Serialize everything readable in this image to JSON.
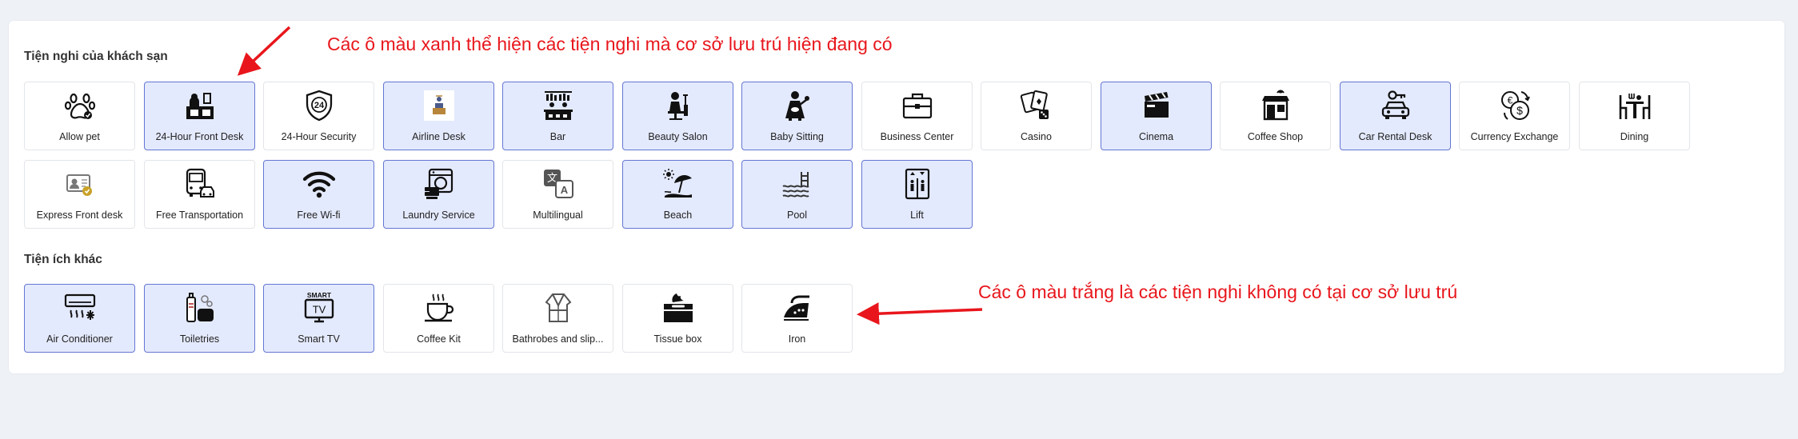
{
  "sections": {
    "hotel_title": "Tiện nghi của khách sạn",
    "other_title": "Tiện ích khác"
  },
  "annotations": {
    "blue_note": "Các ô màu xanh thể hiện các tiện nghi mà cơ sở lưu trú hiện đang có",
    "white_note": "Các ô màu trắng là các tiện nghi không có tại cơ sở lưu trú",
    "color": "#e8161c"
  },
  "colors": {
    "active_bg": "#e4eafd",
    "active_border": "#6476d3",
    "page_bg": "#eef1f6"
  },
  "hotel_amenities": [
    {
      "label": "Allow pet",
      "icon": "paw-icon",
      "active": false
    },
    {
      "label": "24-Hour Front Desk",
      "icon": "front-desk-icon",
      "active": true
    },
    {
      "label": "24-Hour Security",
      "icon": "shield-24-icon",
      "active": false
    },
    {
      "label": "Airline Desk",
      "icon": "airline-desk-icon",
      "active": true
    },
    {
      "label": "Bar",
      "icon": "bar-icon",
      "active": true
    },
    {
      "label": "Beauty Salon",
      "icon": "beauty-salon-icon",
      "active": true
    },
    {
      "label": "Baby Sitting",
      "icon": "baby-sitting-icon",
      "active": true
    },
    {
      "label": "Business Center",
      "icon": "briefcase-icon",
      "active": false
    },
    {
      "label": "Casino",
      "icon": "casino-cards-icon",
      "active": false
    },
    {
      "label": "Cinema",
      "icon": "clapperboard-icon",
      "active": true
    },
    {
      "label": "Coffee Shop",
      "icon": "coffee-shop-icon",
      "active": false
    },
    {
      "label": "Car Rental Desk",
      "icon": "car-key-icon",
      "active": true
    },
    {
      "label": "Currency Exchange",
      "icon": "currency-exchange-icon",
      "active": false
    },
    {
      "label": "Dining",
      "icon": "dining-icon",
      "active": false
    },
    {
      "label": "Express Front desk",
      "icon": "id-card-icon",
      "active": false
    },
    {
      "label": "Free Transportation",
      "icon": "bus-car-icon",
      "active": false
    },
    {
      "label": "Free Wi-fi",
      "icon": "wifi-icon",
      "active": true
    },
    {
      "label": "Laundry Service",
      "icon": "washing-machine-icon",
      "active": true
    },
    {
      "label": "Multilingual",
      "icon": "translate-icon",
      "active": false
    },
    {
      "label": "Beach",
      "icon": "beach-umbrella-icon",
      "active": true
    },
    {
      "label": "Pool",
      "icon": "pool-icon",
      "active": true
    },
    {
      "label": "Lift",
      "icon": "elevator-icon",
      "active": true
    }
  ],
  "other_amenities": [
    {
      "label": "Air Conditioner",
      "icon": "air-conditioner-icon",
      "active": true
    },
    {
      "label": "Toiletries",
      "icon": "toiletries-icon",
      "active": true
    },
    {
      "label": "Smart TV",
      "icon": "smart-tv-icon",
      "active": true,
      "icon_text": "SMART"
    },
    {
      "label": "Coffee Kit",
      "icon": "coffee-cup-icon",
      "active": false
    },
    {
      "label": "Bathrobes and slip...",
      "icon": "bathrobe-icon",
      "active": false
    },
    {
      "label": "Tissue box",
      "icon": "tissue-box-icon",
      "active": false
    },
    {
      "label": "Iron",
      "icon": "iron-icon",
      "active": false
    }
  ]
}
